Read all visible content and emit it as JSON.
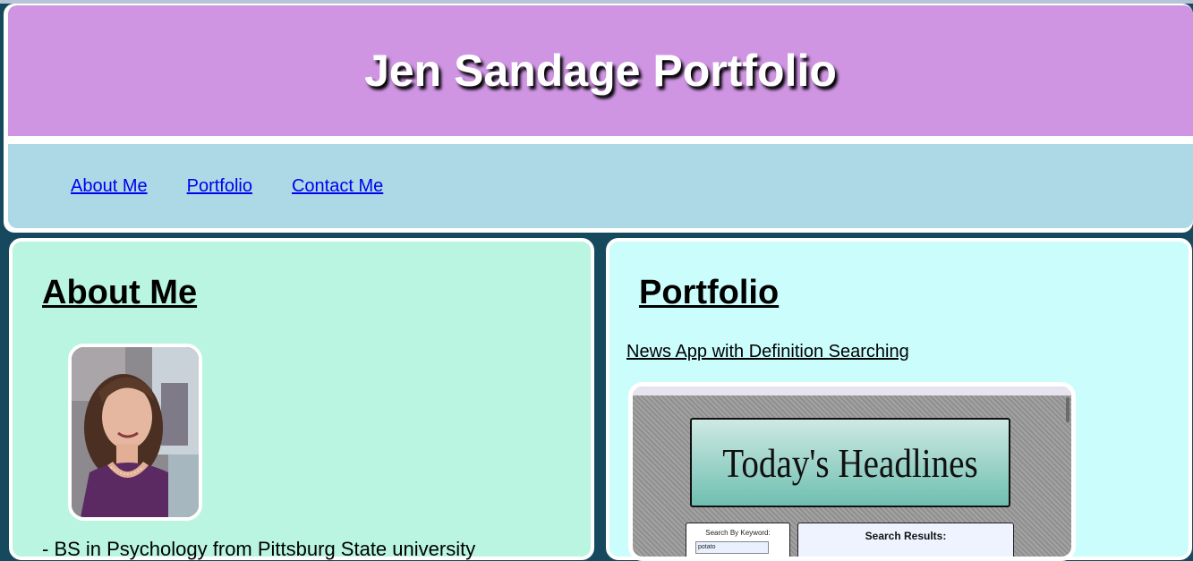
{
  "site": {
    "title": "Jen Sandage Portfolio"
  },
  "nav": {
    "items": [
      {
        "label": "About Me"
      },
      {
        "label": "Portfolio"
      },
      {
        "label": "Contact Me"
      }
    ]
  },
  "about": {
    "heading": "About Me",
    "bullets": [
      "- BS in Psychology from Pittsburg State university"
    ]
  },
  "portfolio": {
    "heading": "Portfolio",
    "project": {
      "link": "News App with Definition Searching",
      "screenshot": {
        "headline": "Today's Headlines",
        "search_label": "Search By Keyword:",
        "search_value": "potato",
        "results_label": "Search Results:"
      }
    }
  },
  "colors": {
    "page_bg": "#17495e",
    "header_bg": "#cf95e3",
    "nav_bg": "#add8e6",
    "about_bg": "#baf5e1",
    "portfolio_bg": "#cbfdfd"
  }
}
